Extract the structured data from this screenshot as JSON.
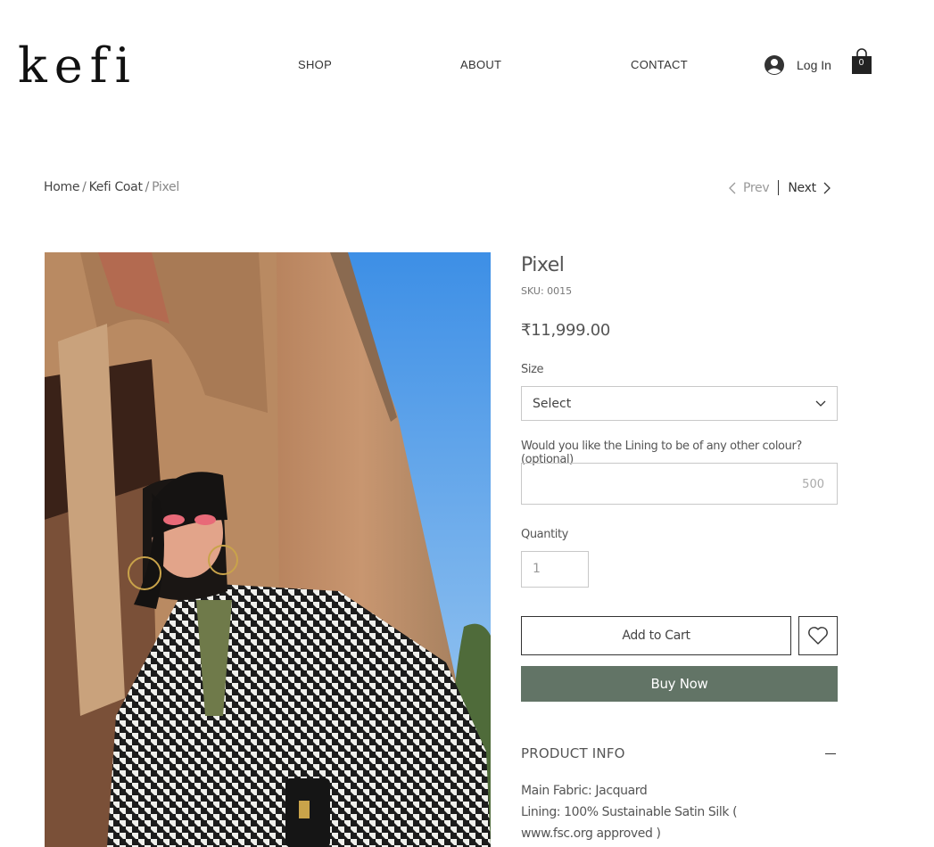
{
  "header": {
    "logo": "kefi",
    "nav": [
      "SHOP",
      "ABOUT",
      "CONTACT"
    ],
    "login_label": "Log In",
    "cart_count": "0"
  },
  "breadcrumb": {
    "home": "Home",
    "category": "Kefi Coat",
    "current": "Pixel",
    "separator": "/"
  },
  "pager": {
    "prev": "Prev",
    "next": "Next"
  },
  "product": {
    "title": "Pixel",
    "sku": "SKU: 0015",
    "price": "₹11,999.00",
    "size_label": "Size",
    "size_value": "Select",
    "lining_label": "Would you like the Lining to be of any other colour? (optional)",
    "lining_counter": "500",
    "quantity_label": "Quantity",
    "quantity_value": "1",
    "add_to_cart": "Add to Cart",
    "buy_now": "Buy Now",
    "info_heading": "PRODUCT INFO",
    "info_lines": [
      "Main Fabric: Jacquard",
      "Lining: 100% Sustainable Satin Silk ( www.fsc.org approved )"
    ]
  },
  "colors": {
    "buy_button": "#627466",
    "text": "#555555"
  },
  "icons": [
    "user-avatar-icon",
    "shopping-bag-icon",
    "chevron-left-icon",
    "chevron-right-icon",
    "chevron-down-icon",
    "heart-icon",
    "minus-icon"
  ]
}
